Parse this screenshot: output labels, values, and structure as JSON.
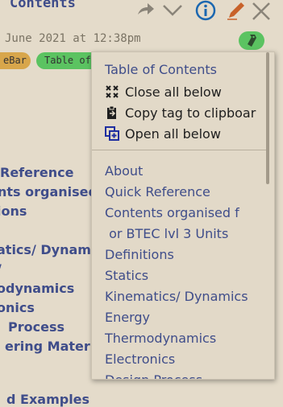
{
  "tiddler": {
    "title": "Contents",
    "subtitle": "June 2021 at 12:38pm"
  },
  "tags": [
    {
      "label": "eBar",
      "color": "#d8a64b"
    },
    {
      "label": "Table of",
      "color": "#5bc361"
    }
  ],
  "toolbar": {
    "icons": [
      "chevron-right-icon",
      "chevron-down-icon",
      "info-icon",
      "edit-icon",
      "close-icon"
    ],
    "info_color": "#1b67b0",
    "edit_color": "#c8622a",
    "tag_button_color": "#5bc361"
  },
  "body_links": [
    "Reference",
    "nts organised",
    "ions",
    "atics/ Dynamic",
    "/",
    "odynamics",
    "onics",
    "Process",
    "ering Materia",
    "d Examples"
  ],
  "dropdown": {
    "title": "Table of Contents",
    "actions": [
      {
        "label": "Close all below",
        "icon": "close-all-icon"
      },
      {
        "label": "Copy tag to clipboar",
        "icon": "copy-clipboard-icon"
      },
      {
        "label": "Open all below",
        "icon": "open-all-icon"
      }
    ],
    "items": [
      "About",
      "Quick Reference",
      "Contents organised f",
      " or BTEC lvl 3 Units",
      "Definitions",
      "Statics",
      "Kinematics/ Dynamics",
      "Energy",
      "Thermodynamics",
      "Electronics",
      "Design Process"
    ]
  }
}
